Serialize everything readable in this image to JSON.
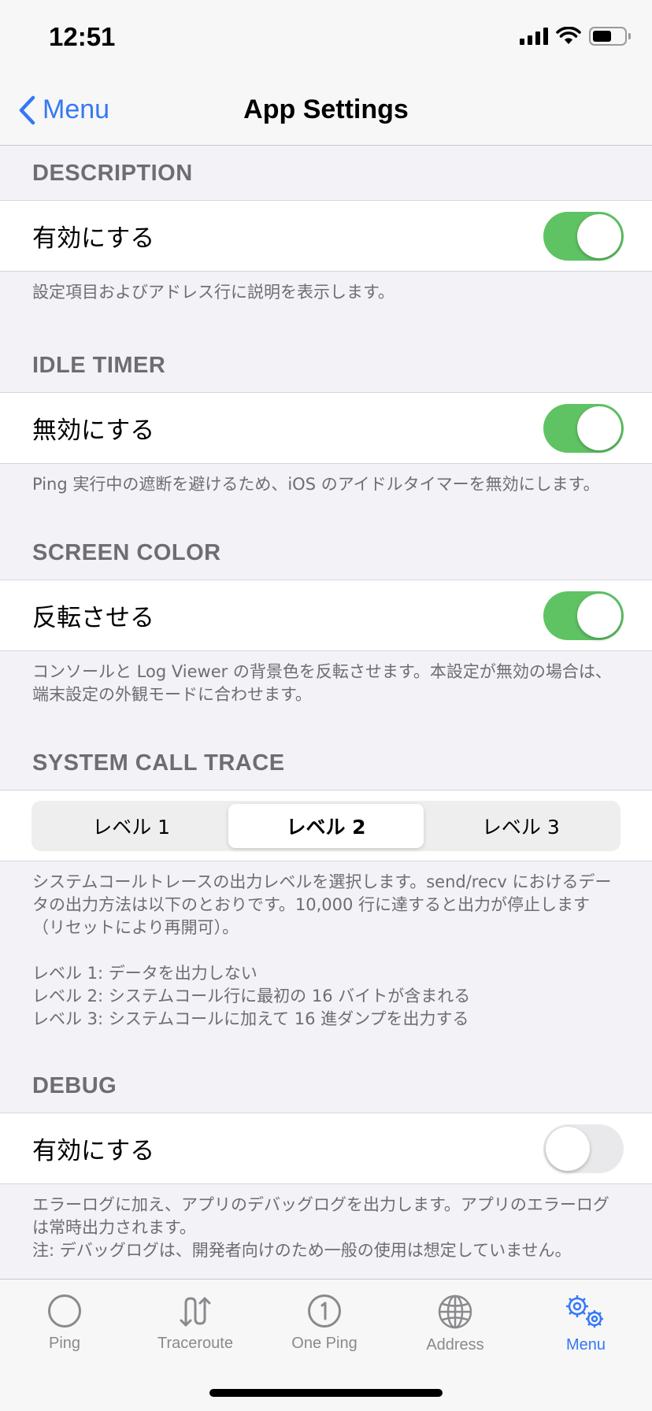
{
  "status": {
    "time": "12:51"
  },
  "nav": {
    "back_label": "Menu",
    "title": "App Settings"
  },
  "sections": {
    "description": {
      "header": "DESCRIPTION",
      "row_label": "有効にする",
      "toggle_on": true,
      "footer": "設定項目およびアドレス行に説明を表示します。"
    },
    "idle_timer": {
      "header": "IDLE TIMER",
      "row_label": "無効にする",
      "toggle_on": true,
      "footer": "Ping 実行中の遮断を避けるため、iOS のアイドルタイマーを無効にします。"
    },
    "screen_color": {
      "header": "SCREEN COLOR",
      "row_label": "反転させる",
      "toggle_on": true,
      "footer": "コンソールと Log Viewer の背景色を反転させます。本設定が無効の場合は、端末設定の外観モードに合わせます。"
    },
    "system_call_trace": {
      "header": "SYSTEM CALL TRACE",
      "segments": [
        "レベル 1",
        "レベル 2",
        "レベル 3"
      ],
      "selected": "レベル 2",
      "footer_main": "システムコールトレースの出力レベルを選択します。send/recv におけるデータの出力方法は以下のとおりです。10,000 行に達すると出力が停止します（リセットにより再開可）。",
      "footer_level1": "レベル 1: データを出力しない",
      "footer_level2": "レベル 2: システムコール行に最初の 16 バイトが含まれる",
      "footer_level3": "レベル 3: システムコールに加えて 16 進ダンプを出力する"
    },
    "debug": {
      "header": "DEBUG",
      "row_label": "有効にする",
      "toggle_on": false,
      "footer_line1": "エラーログに加え、アプリのデバッグログを出力します。アプリのエラーログは常時出力されます。",
      "footer_line2": "注: デバッグログは、開発者向けのため一般の使用は想定していません。"
    }
  },
  "tabs": [
    {
      "label": "Ping",
      "icon": "circle-icon",
      "active": false
    },
    {
      "label": "Traceroute",
      "icon": "traceroute-icon",
      "active": false
    },
    {
      "label": "One Ping",
      "icon": "one-circle-icon",
      "active": false
    },
    {
      "label": "Address",
      "icon": "globe-icon",
      "active": false
    },
    {
      "label": "Menu",
      "icon": "gears-icon",
      "active": true
    }
  ],
  "colors": {
    "accent": "#3478f6",
    "toggle_on": "#5fc364",
    "background": "#f2f2f7",
    "secondary_text": "#6d6d72"
  }
}
